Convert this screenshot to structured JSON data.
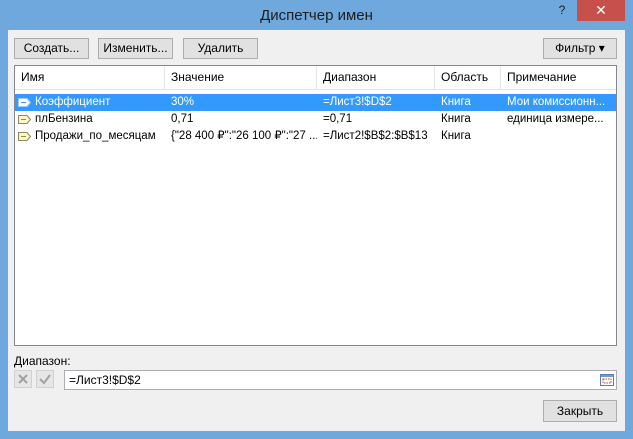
{
  "window": {
    "title": "Диспетчер имен",
    "help": "?",
    "close": "✕"
  },
  "toolbar": {
    "create_label": "Создать...",
    "edit_label": "Изменить...",
    "delete_label": "Удалить",
    "filter_label": "Фильтр ▾"
  },
  "table": {
    "columns": [
      "Имя",
      "Значение",
      "Диапазон",
      "Область",
      "Примечание"
    ],
    "rows": [
      {
        "name": "Коэффициент",
        "value": "30%",
        "range": "=Лист3!$D$2",
        "scope": "Книга",
        "note": "Мои комиссионн...",
        "selected": true
      },
      {
        "name": "плБензина",
        "value": "0,71",
        "range": "=0,71",
        "scope": "Книга",
        "note": "единица измере...",
        "selected": false
      },
      {
        "name": "Продажи_по_месяцам",
        "value": "{\"28 400 ₽\":\"26 100 ₽\":\"27 ...",
        "range": "=Лист2!$B$2:$B$13",
        "scope": "Книга",
        "note": "",
        "selected": false
      }
    ]
  },
  "range_section": {
    "label": "Диапазон:",
    "value": "=Лист3!$D$2"
  },
  "footer": {
    "close_label": "Закрыть"
  },
  "colors": {
    "title_bar": "#6fa8dc",
    "close_button": "#c7504b",
    "selection": "#3399ff"
  }
}
